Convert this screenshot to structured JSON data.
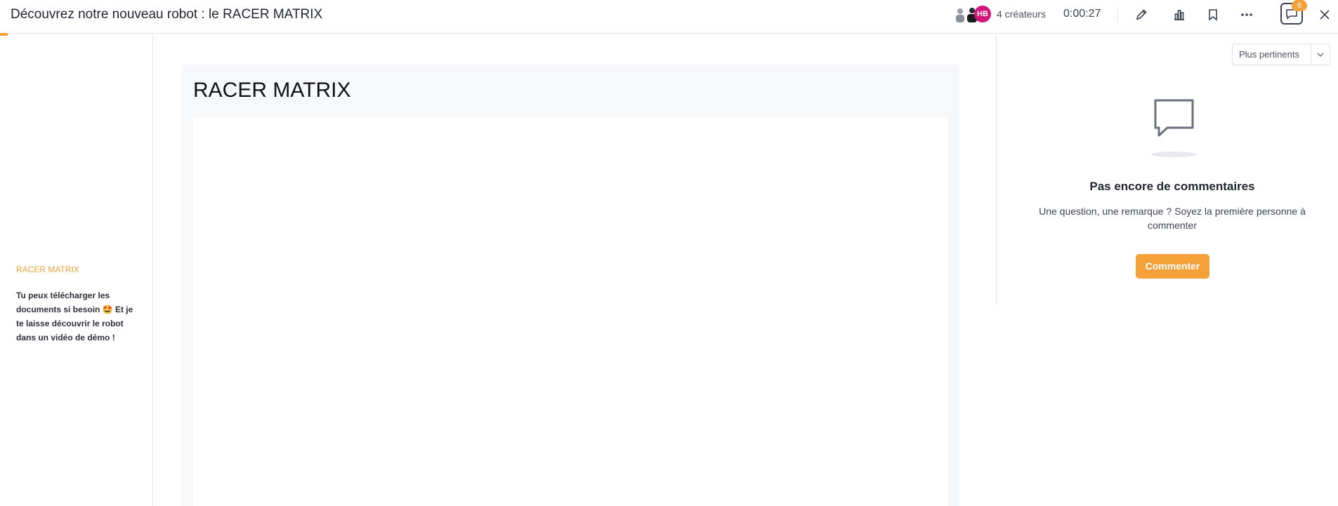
{
  "header": {
    "title": "Découvrez notre nouveau robot : le RACER MATRIX",
    "avatar_initials": "HB",
    "creators_label": "4 créateurs",
    "timer": "0:00:27",
    "comment_count": "6",
    "progress_percent": 1,
    "accent_color": "#f4a13a",
    "icons": [
      "edit-icon",
      "stats-icon",
      "bookmark-icon",
      "more-icon",
      "comments-icon",
      "close-icon"
    ]
  },
  "sidebar": {
    "heading": "RACER MATRIX",
    "description": "Tu peux télécharger les documents si besoin 🤩 Et je te laisse découvrir le robot dans un vidéo de démo !"
  },
  "main": {
    "doc_title": "RACER MATRIX"
  },
  "comments": {
    "sort_selected": "Plus pertinents",
    "empty_title": "Pas encore de commentaires",
    "empty_text": "Une question, une remarque ? Soyez la première personne à commenter",
    "button_label": "Commenter"
  }
}
